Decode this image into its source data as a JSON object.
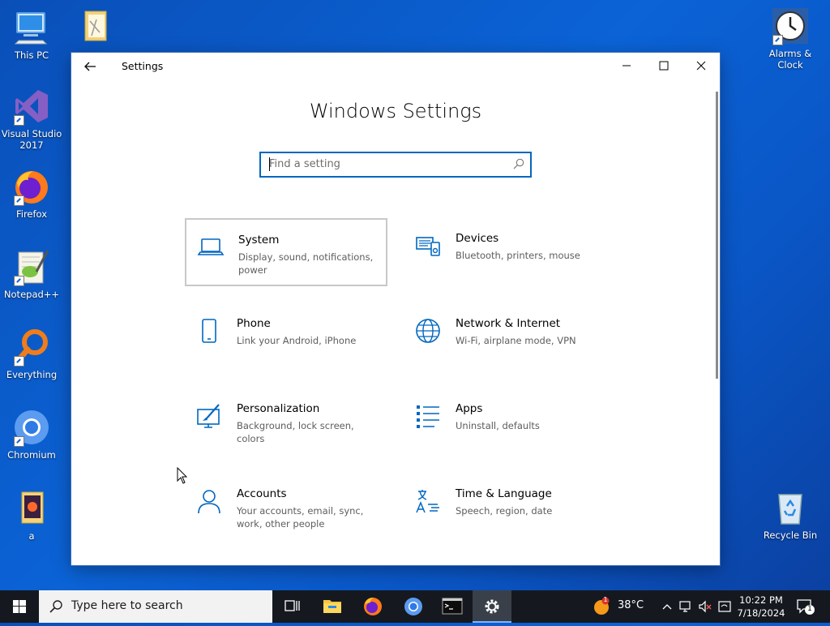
{
  "desktop": {
    "icons_left": [
      {
        "label": "This PC"
      },
      {
        "label": "Visual Studio 2017"
      },
      {
        "label": "Firefox"
      },
      {
        "label": "Notepad++"
      },
      {
        "label": "Everything"
      },
      {
        "label": "Chromium"
      },
      {
        "label": "a"
      }
    ],
    "icons_right": [
      {
        "label": "Alarms & Clock"
      },
      {
        "label": "Recycle Bin"
      }
    ]
  },
  "window": {
    "title": "Settings",
    "heading": "Windows Settings",
    "search_placeholder": "Find a setting",
    "tiles": [
      {
        "name": "System",
        "desc": "Display, sound, notifications, power"
      },
      {
        "name": "Devices",
        "desc": "Bluetooth, printers, mouse"
      },
      {
        "name": "Phone",
        "desc": "Link your Android, iPhone"
      },
      {
        "name": "Network & Internet",
        "desc": "Wi-Fi, airplane mode, VPN"
      },
      {
        "name": "Personalization",
        "desc": "Background, lock screen, colors"
      },
      {
        "name": "Apps",
        "desc": "Uninstall, defaults"
      },
      {
        "name": "Accounts",
        "desc": "Your accounts, email, sync, work, other people"
      },
      {
        "name": "Time & Language",
        "desc": "Speech, region, date"
      }
    ]
  },
  "taskbar": {
    "search_text": "Type here to search",
    "weather": "38°C",
    "time": "10:22 PM",
    "date": "7/18/2024",
    "notification_count": "1",
    "weather_badge": "1"
  },
  "colors": {
    "accent": "#0067c0",
    "taskbar": "#15191f",
    "desktop": "#0b63d6"
  }
}
